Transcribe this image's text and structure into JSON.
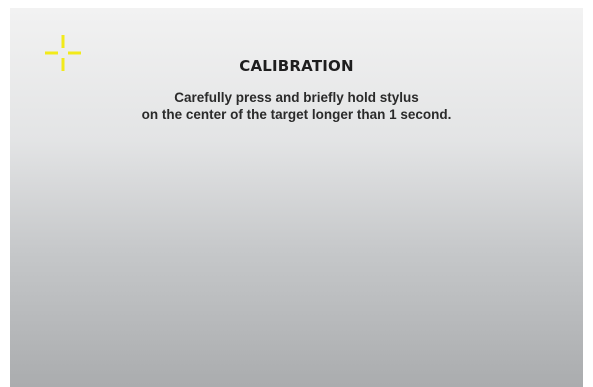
{
  "calibration": {
    "title": "CALIBRATION",
    "instruction_line1": "Carefully press and briefly hold stylus",
    "instruction_line2": "on the center of the target longer than 1 second.",
    "target_icon": "crosshair-target-icon",
    "target_color": "#f2ea1a"
  }
}
